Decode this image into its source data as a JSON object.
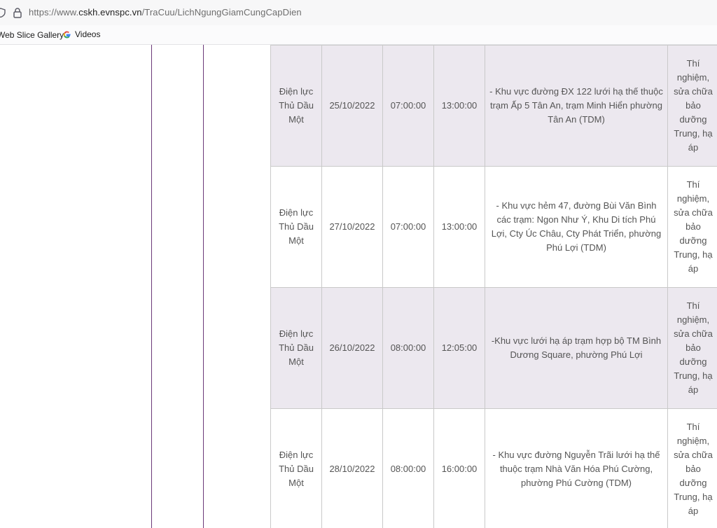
{
  "browser": {
    "url_prefix": "https://www.",
    "url_host": "cskh.evnspc.vn",
    "url_path": "/TraCuu/LichNgungGiamCungCapDien",
    "bookmarks": [
      {
        "label": "Web Slice Gallery",
        "icon": "web-slice-icon"
      },
      {
        "label": "Videos",
        "icon": "google-g-icon"
      }
    ]
  },
  "schedule": {
    "rows": [
      {
        "unit": "Điện lực Thủ Dầu Một",
        "date": "25/10/2022",
        "start": "07:00:00",
        "end": "13:00:00",
        "area": "- Khu vực đường ĐX 122 lưới hạ thế thuộc trạm Ấp 5 Tân An, trạm Minh Hiển phường Tân An (TDM)",
        "reason": "Thí nghiệm, sửa chữa bảo dưỡng Trung, hạ áp"
      },
      {
        "unit": "Điện lực Thủ Dầu Một",
        "date": "27/10/2022",
        "start": "07:00:00",
        "end": "13:00:00",
        "area": "- Khu vực hẻm 47, đường Bùi Văn Bình các trạm: Ngon Như Ý, Khu Di tích Phú Lợi, Cty Úc Châu, Cty Phát Triển, phường Phú Lợi (TDM)",
        "reason": "Thí nghiệm, sửa chữa bảo dưỡng Trung, hạ áp"
      },
      {
        "unit": "Điện lực Thủ Dầu Một",
        "date": "26/10/2022",
        "start": "08:00:00",
        "end": "12:05:00",
        "area": "-Khu vực lưới hạ áp trạm hợp bộ TM Bình Dương Square, phường Phú Lợi",
        "reason": "Thí nghiệm, sửa chữa bảo dưỡng Trung, hạ áp"
      },
      {
        "unit": "Điện lực Thủ Dầu Một",
        "date": "28/10/2022",
        "start": "08:00:00",
        "end": "16:00:00",
        "area": "- Khu vực đường Nguyễn Trãi lưới hạ thế thuộc trạm Nhà Văn Hóa Phú Cường, phường Phú Cường (TDM)",
        "reason": "Thí nghiệm, sửa chữa bảo dưỡng Trung, hạ áp"
      }
    ]
  }
}
